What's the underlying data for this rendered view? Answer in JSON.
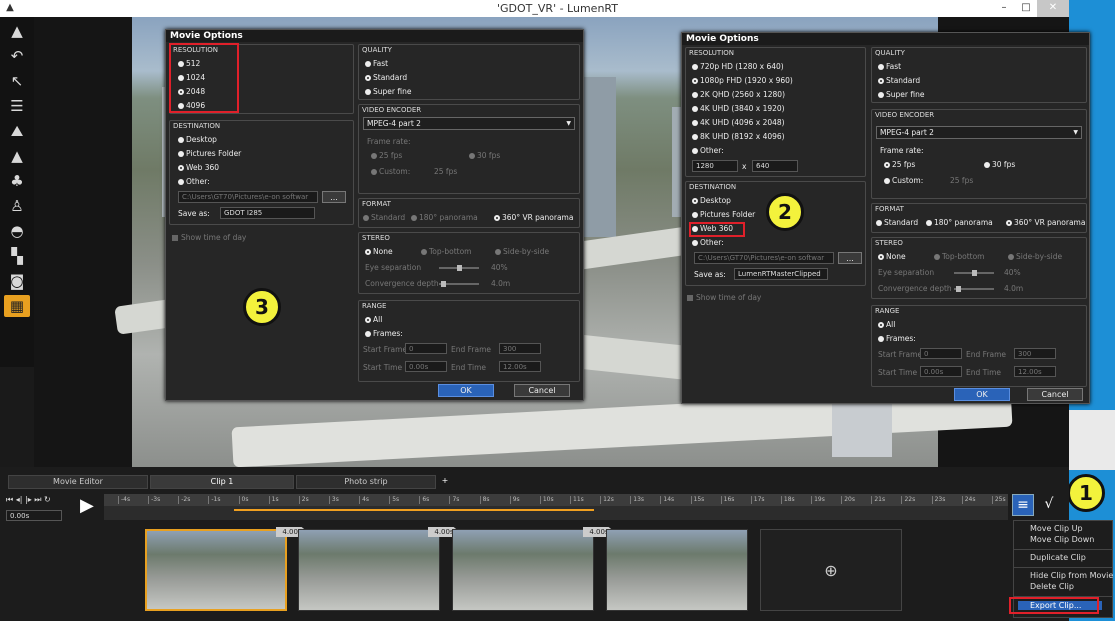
{
  "window": {
    "title": "'GDOT_VR' - LumenRT"
  },
  "toolbar": {
    "tools": [
      "select-arrow-icon",
      "undo-icon",
      "move-icon",
      "adjust-icon",
      "terrain-icon",
      "mountain-icon",
      "tree-icon",
      "person-icon",
      "car-icon",
      "objects-icon",
      "camera-icon",
      "clapper-icon"
    ]
  },
  "dialog_left": {
    "title": "Movie Options",
    "resolution": {
      "label": "RESOLUTION",
      "options": [
        "512",
        "1024",
        "2048",
        "4096"
      ],
      "selected": "2048"
    },
    "destination": {
      "label": "DESTINATION",
      "options": [
        "Desktop",
        "Pictures Folder",
        "Web 360",
        "Other:"
      ],
      "selected": "Web 360",
      "path": "C:\\Users\\GT70\\Pictures\\e-on softwar",
      "browse": "...",
      "save_as_label": "Save as:",
      "save_as_value": "GDOT I285"
    },
    "show_time": "Show time of day",
    "quality": {
      "label": "QUALITY",
      "options": [
        "Fast",
        "Standard",
        "Super fine"
      ],
      "selected": "Standard"
    },
    "video_encoder": {
      "label": "VIDEO ENCODER",
      "value": "MPEG-4 part 2",
      "frame_rate_label": "Frame rate:",
      "fps25": "25 fps",
      "fps30": "30 fps",
      "custom_label": "Custom:",
      "custom_value": "25 fps"
    },
    "format": {
      "label": "FORMAT",
      "standard": "Standard",
      "panorama180": "180° panorama",
      "vr360": "360° VR panorama"
    },
    "stereo": {
      "label": "STEREO",
      "none": "None",
      "top_bottom": "Top-bottom",
      "side_by_side": "Side-by-side",
      "eye_sep_label": "Eye separation",
      "eye_sep_value": "40%",
      "conv_label": "Convergence depth",
      "conv_value": "4.0m"
    },
    "range": {
      "label": "RANGE",
      "all": "All",
      "frames": "Frames:",
      "start_frame_label": "Start Frame",
      "start_frame": "0",
      "end_frame_label": "End Frame",
      "end_frame": "300",
      "start_time_label": "Start Time",
      "start_time": "0.00s",
      "end_time_label": "End Time",
      "end_time": "12.00s"
    },
    "ok": "OK",
    "cancel": "Cancel"
  },
  "dialog_right": {
    "title": "Movie Options",
    "resolution": {
      "label": "RESOLUTION",
      "options": [
        "720p HD (1280 x 640)",
        "1080p FHD (1920 x 960)",
        "2K QHD (2560 x 1280)",
        "4K UHD (3840 x 1920)",
        "4K UHD (4096 x 2048)",
        "8K UHD (8192 x 4096)",
        "Other:"
      ],
      "selected": "1080p FHD (1920 x 960)",
      "w": "1280",
      "x": "x",
      "h": "640"
    },
    "destination": {
      "label": "DESTINATION",
      "options": [
        "Desktop",
        "Pictures Folder",
        "Web 360",
        "Other:"
      ],
      "selected": "Desktop",
      "path": "C:\\Users\\GT70\\Pictures\\e-on softwar",
      "browse": "...",
      "save_as_label": "Save as:",
      "save_as_value": "LumenRTMasterClipped"
    },
    "show_time": "Show time of day",
    "quality": {
      "label": "QUALITY",
      "options": [
        "Fast",
        "Standard",
        "Super fine"
      ],
      "selected": "Standard"
    },
    "video_encoder": {
      "label": "VIDEO ENCODER",
      "value": "MPEG-4 part 2",
      "frame_rate_label": "Frame rate:",
      "fps25": "25 fps",
      "fps30": "30 fps",
      "custom_label": "Custom:",
      "custom_value": "25 fps"
    },
    "format": {
      "label": "FORMAT",
      "standard": "Standard",
      "panorama180": "180° panorama",
      "vr360": "360° VR panorama"
    },
    "stereo": {
      "label": "STEREO",
      "none": "None",
      "top_bottom": "Top-bottom",
      "side_by_side": "Side-by-side",
      "eye_sep_label": "Eye separation",
      "eye_sep_value": "40%",
      "conv_label": "Convergence depth",
      "conv_value": "4.0m"
    },
    "range": {
      "label": "RANGE",
      "all": "All",
      "frames": "Frames:",
      "start_frame_label": "Start Frame",
      "start_frame": "0",
      "end_frame_label": "End Frame",
      "end_frame": "300",
      "start_time_label": "Start Time",
      "start_time": "0.00s",
      "end_time_label": "End Time",
      "end_time": "12.00s"
    },
    "ok": "OK",
    "cancel": "Cancel"
  },
  "badges": {
    "one": "1",
    "two": "2",
    "three": "3"
  },
  "timeline": {
    "tabs": [
      "Movie Editor",
      "Clip 1",
      "Photo strip"
    ],
    "add_tab": "+",
    "time_value": "0.00s",
    "ruler_ticks": [
      "-4s",
      "-3s",
      "-2s",
      "-1s",
      "0s",
      "1s",
      "2s",
      "3s",
      "4s",
      "5s",
      "6s",
      "7s",
      "8s",
      "9s",
      "10s",
      "11s",
      "12s",
      "13s",
      "14s",
      "15s",
      "16s",
      "17s",
      "18s",
      "19s",
      "20s",
      "21s",
      "22s",
      "23s",
      "24s",
      "25s"
    ],
    "durations": [
      "4.00s",
      "4.00s",
      "4.00s"
    ]
  },
  "context_menu": {
    "items": [
      "Move Clip Up",
      "Move Clip Down",
      "Duplicate Clip",
      "Hide Clip from Movie",
      "Delete Clip",
      "Export Clip..."
    ]
  },
  "colors": {
    "accent": "#e8a020",
    "highlight": "#e0202a",
    "badge": "#f3f23c",
    "ok_button": "#2a63b8"
  }
}
